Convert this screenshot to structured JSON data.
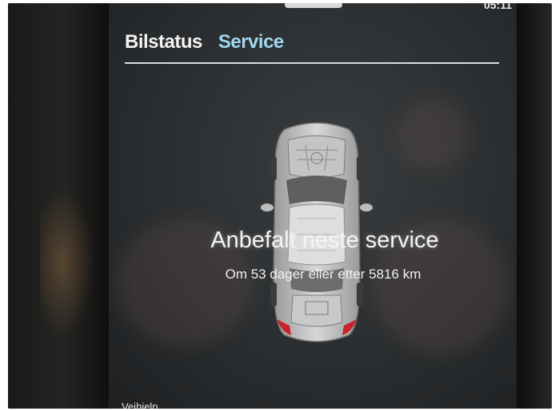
{
  "status_bar": {
    "clock": "05:11"
  },
  "tabs": [
    {
      "label": "Bilstatus",
      "active": true
    },
    {
      "label": "Service",
      "active": false
    }
  ],
  "service": {
    "title": "Anbefalt neste service",
    "subtitle": "Om 53 dager eller etter 5816 km"
  },
  "bottom": {
    "label": "Veihjelp"
  },
  "colors": {
    "screen_bg": "#2b2e30",
    "tab_active": "#f2f2f2",
    "tab_inactive": "#9fd6ee",
    "tail_light": "#c8242b"
  },
  "icons": {
    "car": "car-top-view-icon"
  }
}
